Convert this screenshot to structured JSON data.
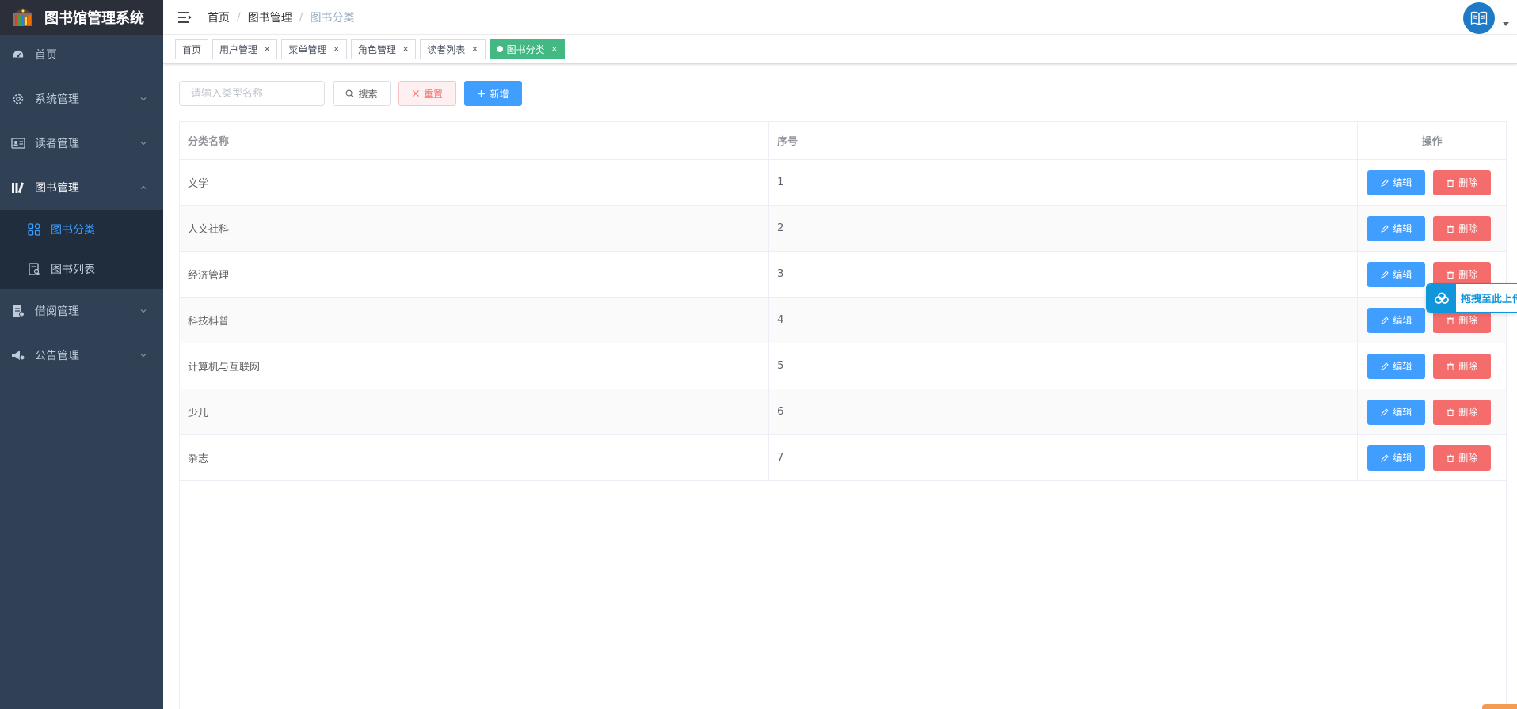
{
  "app": {
    "title": "图书馆管理系统"
  },
  "sidebar": {
    "items": [
      {
        "label": "首页",
        "icon": "dashboard-icon"
      },
      {
        "label": "系统管理",
        "icon": "gear-icon"
      },
      {
        "label": "读者管理",
        "icon": "id-card-icon"
      },
      {
        "label": "图书管理",
        "icon": "books-icon",
        "expanded": true,
        "children": [
          {
            "label": "图书分类",
            "icon": "category-icon",
            "active": true
          },
          {
            "label": "图书列表",
            "icon": "book-list-icon"
          }
        ]
      },
      {
        "label": "借阅管理",
        "icon": "borrow-icon"
      },
      {
        "label": "公告管理",
        "icon": "megaphone-icon"
      }
    ]
  },
  "header": {
    "breadcrumb": [
      "首页",
      "图书管理",
      "图书分类"
    ]
  },
  "tags": [
    {
      "label": "首页",
      "closable": false,
      "active": false
    },
    {
      "label": "用户管理",
      "closable": true,
      "active": false
    },
    {
      "label": "菜单管理",
      "closable": true,
      "active": false
    },
    {
      "label": "角色管理",
      "closable": true,
      "active": false
    },
    {
      "label": "读者列表",
      "closable": true,
      "active": false
    },
    {
      "label": "图书分类",
      "closable": true,
      "active": true
    }
  ],
  "toolbar": {
    "search_placeholder": "请输入类型名称",
    "search_label": "搜索",
    "reset_label": "重置",
    "add_label": "新增"
  },
  "table": {
    "columns": [
      "分类名称",
      "序号",
      "操作"
    ],
    "rows": [
      {
        "name": "文学",
        "order": "1"
      },
      {
        "name": "人文社科",
        "order": "2"
      },
      {
        "name": "经济管理",
        "order": "3"
      },
      {
        "name": "科技科普",
        "order": "4"
      },
      {
        "name": "计算机与互联网",
        "order": "5"
      },
      {
        "name": "少儿",
        "order": "6"
      },
      {
        "name": "杂志",
        "order": "7"
      }
    ],
    "edit_label": "编辑",
    "delete_label": "删除"
  },
  "upload_widget": {
    "label": "拖拽至此上传"
  },
  "colors": {
    "sidebar_bg": "#304156",
    "logo_bg": "#2b2f3a",
    "submenu_bg": "#1f2d3d",
    "primary": "#409eff",
    "danger": "#f56c6c",
    "active_tag": "#42b983"
  }
}
